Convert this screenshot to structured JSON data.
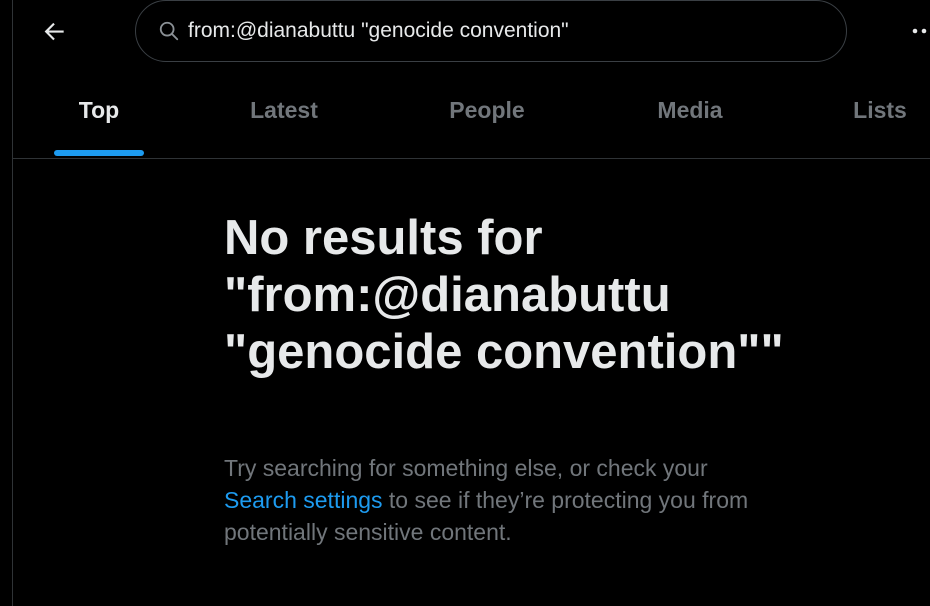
{
  "header": {
    "back_icon": "arrow-left-icon",
    "search": {
      "icon": "search-icon",
      "value": "from:@dianabuttu \"genocide convention\""
    },
    "more_icon": "more-dots-icon"
  },
  "tabs": [
    {
      "label": "Top",
      "active": true
    },
    {
      "label": "Latest",
      "active": false
    },
    {
      "label": "People",
      "active": false
    },
    {
      "label": "Media",
      "active": false
    },
    {
      "label": "Lists",
      "active": false
    }
  ],
  "empty_state": {
    "title": "No results for \"from:@dianabuttu \"genocide convention\"\"",
    "desc_before": "Try searching for something else, or check your ",
    "link_text": "Search settings",
    "desc_after": " to see if they’re protecting you from potentially sensitive content."
  },
  "colors": {
    "background": "#000000",
    "text_primary": "#e7e9ea",
    "text_secondary": "#71767b",
    "accent": "#1d9bf0",
    "border": "#2f3336"
  }
}
